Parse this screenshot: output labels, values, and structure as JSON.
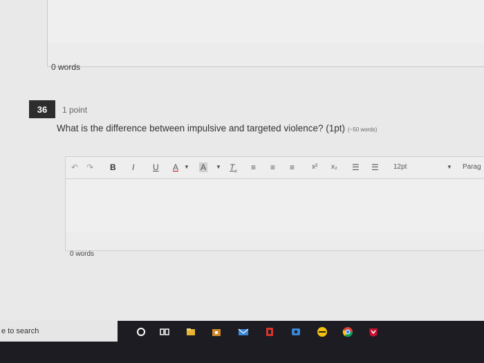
{
  "previous_answer": {
    "word_count": "0 words"
  },
  "question": {
    "number": "36",
    "points": "1 point",
    "text": "What is the difference between impulsive and targeted violence? (1pt)",
    "hint": "(~50 words)"
  },
  "toolbar": {
    "bold": "B",
    "italic": "I",
    "underline": "U",
    "font_color": "A",
    "highlight": "A",
    "superscript": "x²",
    "subscript": "x₂",
    "font_size": "12pt",
    "paragraph": "Parag"
  },
  "editor": {
    "word_count": "0 words"
  },
  "taskbar": {
    "search_text": "e to search",
    "icons": [
      "cortana-icon",
      "task-view-icon",
      "file-explorer-icon",
      "store-icon",
      "mail-icon",
      "office-icon",
      "camera-icon",
      "chrome-icon",
      "mcafee-icon"
    ],
    "colors": {
      "file-explorer": "#e8b530",
      "store": "#d18a2c",
      "mail": "#3a86d6",
      "office": "#d9352b",
      "chrome": "#f4c20d",
      "mcafee": "#c8102e"
    }
  }
}
